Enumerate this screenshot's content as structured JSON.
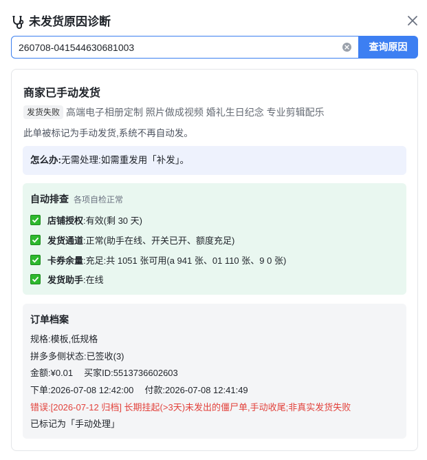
{
  "header": {
    "title": "未发货原因诊断"
  },
  "search": {
    "value": "260708-041544630681003",
    "button_label": "查询原因"
  },
  "result": {
    "title": "商家已手动发货",
    "status_tag": "发货失败",
    "product_name": "高端电子相册定制 照片做成视频 婚礼生日纪念 专业剪辑配乐",
    "description": "此单被标记为手动发货,系统不再自动发。",
    "todo": {
      "key": "怎么办:",
      "value": "无需处理:如需重发用「补发」。"
    },
    "auto_check": {
      "title": "自动排查",
      "subtitle": "各项自检正常",
      "items": [
        {
          "key": "店铺授权",
          "value": ":有效(剩 30 天)"
        },
        {
          "key": "发货通道",
          "value": ":正常(助手在线、开关已开、额度充足)"
        },
        {
          "key": "卡券余量",
          "value": ":充足:共 1051 张可用(a 941 张、01 110 张、9 0 张)"
        },
        {
          "key": "发货助手",
          "value": ":在线"
        }
      ]
    },
    "archive": {
      "title": "订单档案",
      "spec": "规格:模板,低规格",
      "pdd_status": "拼多多侧状态:已签收(3)",
      "amount": "金额:¥0.01",
      "buyer": "买家ID:5513736602603",
      "order_time": "下单:2026-07-08 12:42:00",
      "pay_time": "付款:2026-07-08 12:41:49",
      "error": "错误:[2026-07-12 归档] 长期挂起(>3天)未发出的僵尸单,手动收尾;非真实发货失败",
      "marked": "已标记为「手动处理」"
    }
  },
  "colors": {
    "accent": "#3d7ff2",
    "success": "#2eb82e",
    "error": "#e2413b",
    "todo_bg": "#eef2fd",
    "check_bg": "#e9f7f0",
    "archive_bg": "#f4f5f7"
  }
}
